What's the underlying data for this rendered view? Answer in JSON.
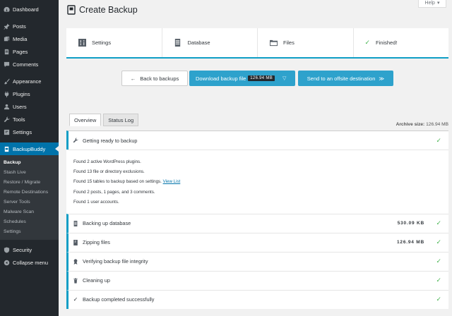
{
  "sidebar": {
    "items": [
      {
        "label": "Dashboard",
        "icon": "dashboard-icon"
      },
      {
        "label": "Posts",
        "icon": "pin-icon"
      },
      {
        "label": "Media",
        "icon": "media-icon"
      },
      {
        "label": "Pages",
        "icon": "pages-icon"
      },
      {
        "label": "Comments",
        "icon": "comments-icon"
      },
      {
        "label": "Appearance",
        "icon": "brush-icon"
      },
      {
        "label": "Plugins",
        "icon": "plug-icon"
      },
      {
        "label": "Users",
        "icon": "users-icon"
      },
      {
        "label": "Tools",
        "icon": "wrench-icon"
      },
      {
        "label": "Settings",
        "icon": "settings-icon"
      }
    ],
    "backupbuddy": "BackupBuddy",
    "submenu": [
      "Backup",
      "Stash Live",
      "Restore / Migrate",
      "Remote Destinations",
      "Server Tools",
      "Malware Scan",
      "Schedules",
      "Settings"
    ],
    "security": "Security",
    "collapse": "Collapse menu"
  },
  "help": "Help",
  "page_title": "Create Backup",
  "steps": [
    "Settings",
    "Database",
    "Files",
    "Finished!"
  ],
  "buttons": {
    "back": "Back to backups",
    "download": "Download backup file",
    "download_size": "126.94 MB",
    "offsite": "Send to an offsite destination"
  },
  "tabs": [
    "Overview",
    "Status Log"
  ],
  "archive_size_label": "Archive size:",
  "archive_size_value": "126.94 MB",
  "log": {
    "preparing": "Getting ready to backup",
    "details": [
      "Found 2 active WordPress plugins.",
      "Found 13 file or directory exclusions.",
      "Found 15 tables to backup based on settings.",
      "Found 2 posts, 1 pages, and 3 comments.",
      "Found 1 user accounts."
    ],
    "view_list": "View List",
    "rows": [
      {
        "label": "Backing up database",
        "size": "530.09 KB"
      },
      {
        "label": "Zipping files",
        "size": "126.94 MB"
      },
      {
        "label": "Verifying backup file integrity",
        "size": ""
      },
      {
        "label": "Cleaning up",
        "size": ""
      },
      {
        "label": "Backup completed successfully",
        "size": ""
      }
    ]
  },
  "colors": {
    "accent": "#0073aa",
    "button_blue": "#2ea2cc",
    "success": "#46b450",
    "sidebar_bg": "#23282d"
  }
}
